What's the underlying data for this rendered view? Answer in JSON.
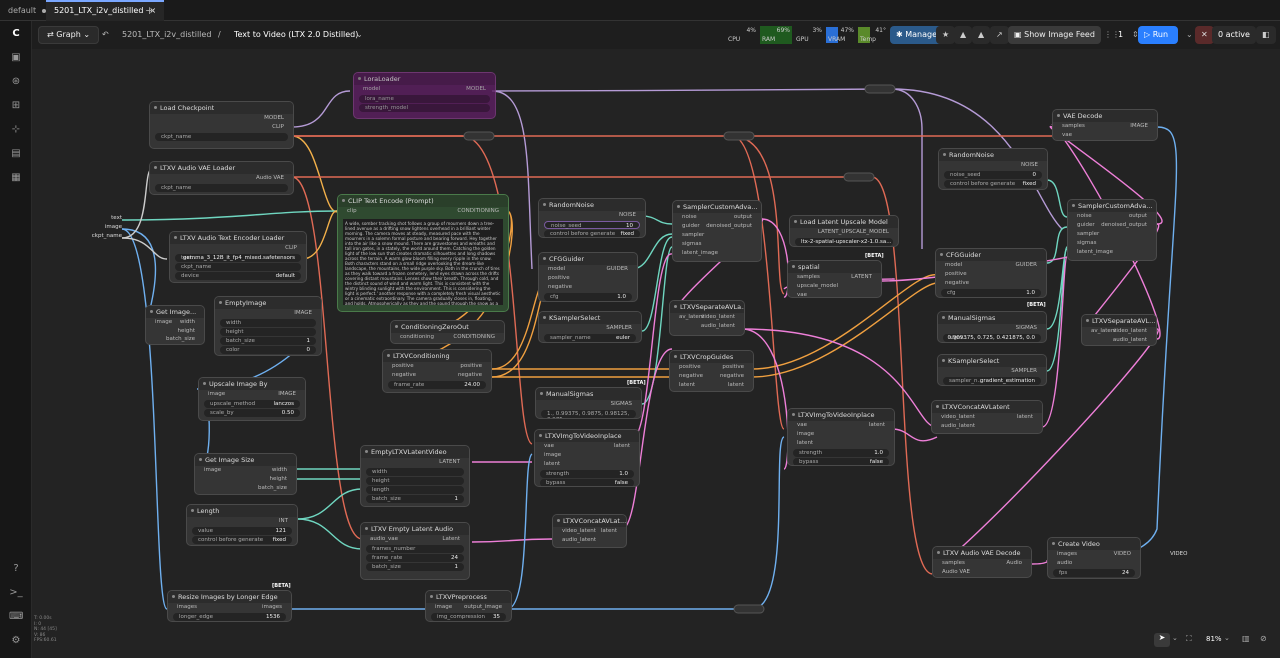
{
  "tabs": [
    {
      "label": "default"
    },
    {
      "label": "5201_LTX_i2v_distilled"
    }
  ],
  "toolbar": {
    "graph_label": "Graph",
    "breadcrumb_parent": "5201_LTX_i2v_distilled",
    "breadcrumb_sep": "/",
    "breadcrumb_current": "Text to Video (LTX 2.0 Distilled)",
    "cpu": {
      "label": "CPU",
      "value": "4%"
    },
    "ram": {
      "label": "RAM",
      "value": "69%"
    },
    "gpu": {
      "label": "GPU",
      "value": "3%"
    },
    "vram": {
      "label": "VRAM",
      "value": "47%"
    },
    "temp": {
      "label": "Temp",
      "value": "41°"
    },
    "manager_label": "Manager",
    "image_feed_label": "Show Image Feed",
    "queue_count": "1",
    "run_label": "Run",
    "active_label": "0 active"
  },
  "colors": {
    "accent": "#2a7fff",
    "ram_green": "#2a8a2a",
    "vram_blue": "#2a6fd6",
    "temp_green": "#5a8a2a",
    "clip_wire": "#f2b04a",
    "model_wire": "#b59bd6",
    "vae_wire": "#e06a55",
    "latent_wire": "#ee7fd8",
    "image_wire": "#6fb0f0",
    "cond_wire": "#f0a040",
    "guider_wire": "#6fd6c0"
  },
  "nodes": {
    "load_checkpoint": {
      "title": "Load Checkpoint",
      "out_model": "MODEL",
      "out_clip": "CLIP",
      "out_vae": "VAE",
      "widget": "ckpt_name"
    },
    "audio_vae_loader": {
      "title": "LTXV Audio VAE Loader",
      "out": "Audio VAE",
      "widget": "ckpt_name"
    },
    "text_encoder_loader": {
      "title": "LTXV Audio Text Encoder Loader",
      "out": "CLIP",
      "w1_label": "text...",
      "w1_value": "gemma_3_12B_it_fp4_mixed.safetensors",
      "w2_label": "ckpt_name",
      "w3_label": "device",
      "w3_value": "default"
    },
    "inputs": {
      "text": "text",
      "image": "image",
      "ckpt_name": "ckpt_name"
    },
    "get_image": {
      "title": "Get Image...",
      "in": "image",
      "width": "width",
      "height": "height",
      "batch_size": "batch_size"
    },
    "empty_image": {
      "title": "EmptyImage",
      "out": "IMAGE",
      "w1": "width",
      "w2": "height",
      "w3_label": "batch_size",
      "w3_value": "1",
      "w4_label": "color",
      "w4_value": "0"
    },
    "upscale_image_by": {
      "title": "Upscale Image By",
      "in": "image",
      "out": "IMAGE",
      "w1_label": "upscale_method",
      "w1_value": "lanczos",
      "w2_label": "scale_by",
      "w2_value": "0.50"
    },
    "get_image_size": {
      "title": "Get Image Size",
      "in": "image",
      "width": "width",
      "height": "height",
      "batch_size": "batch_size"
    },
    "length": {
      "title": "Length",
      "out": "INT",
      "w1_label": "value",
      "w1_value": "121",
      "w2_label": "control before generate",
      "w2_value": "fixed"
    },
    "resize_longer_edge": {
      "title": "Resize Images by Longer Edge",
      "in": "images",
      "out": "images",
      "w1_label": "longer_edge",
      "w1_value": "1536",
      "beta": "[BETA]"
    },
    "ltxv_preprocess": {
      "title": "LTXVPreprocess",
      "in": "image",
      "out": "output_image",
      "w1_label": "img_compression",
      "w1_value": "35"
    },
    "model_sampling_bypassed": {
      "title": "LoraLoader",
      "in": "model",
      "out": "MODEL",
      "w1": "lora_name",
      "w2": "strength_model"
    },
    "clip_text_encode": {
      "title": "CLIP Text Encode (Prompt)",
      "in": "clip",
      "out": "CONDITIONING",
      "text": "A wide, somber tracking shot follows a group of mourners down a tree-lined avenue as a drifting snow lightens overhead in a brilliant winter morning. The camera moves at steady, measured pace with the mourners in a solemn formal posture and bearing forward. Hey together into the air like a snow mound. There are gravestones and wreaths and tall iron gates, in a stately, the world around them. Catching the golden light of the low sun that creates dramatic silhouettes and long shadows across the terrain. A warm glow bloom filling every ripple in the snow. Both characters stand on a small ridge overlooking the dream-like landscape, the mountains, the wide purple sky. Both in the crunch of tires as they walk toward a frozen cemetery, lend eyes drawn across the drifts covering distant mountains. Lenses show their breath. Through cold, and the distinct sound of wind and warm light. This is consistent with the wintry blinding sunlight with the environment. This is considering the light is perfect.' another response with a completely fresh visual aesthetic or a cinematic extraordinary. The camera gradually closes in, floating, and holds. Atmospherically as they and the sound through the snow as a faint light in the sky. A distant sound of birds overhead, a bridge across the river, slightly silvering the sky. The clear and brilliant, along the edge. The mood is contemplative, hard-edged, and full of the fine detail of winter morning, with ethnic hope and grief captured in crisp light against the brilliant white snow and vibrant sky."
    },
    "cond_zero_out": {
      "title": "ConditioningZeroOut",
      "in": "conditioning",
      "out": "CONDITIONING"
    },
    "ltxv_conditioning": {
      "title": "LTXVConditioning",
      "in_pos": "positive",
      "in_neg": "negative",
      "out_pos": "positive",
      "out_neg": "negative",
      "w1_label": "frame_rate",
      "w1_value": "24.00"
    },
    "random_noise_1": {
      "title": "RandomNoise",
      "out": "NOISE",
      "w1_label": "noise_seed",
      "w1_value": "10",
      "w2_label": "control before generate",
      "w2_value": "fixed"
    },
    "cfg_guider_1": {
      "title": "CFGGuider",
      "in1": "model",
      "in2": "positive",
      "in3": "negative",
      "out": "GUIDER",
      "w1_label": "cfg",
      "w1_value": "1.0"
    },
    "ksampler_select_1": {
      "title": "KSamplerSelect",
      "out": "SAMPLER",
      "w1_label": "sampler_name",
      "w1_value": "euler"
    },
    "manual_sigmas_1": {
      "title": "ManualSigmas",
      "out": "SIGMAS",
      "w1_value": "1., 0.99375, 0.9875, 0.98125, 0.975,..."
    },
    "sampler_custom_1": {
      "title": "SamplerCustomAdva...",
      "in": [
        "noise",
        "guider",
        "sampler",
        "sigmas",
        "latent_image"
      ],
      "out1": "output",
      "out2": "denoised_output"
    },
    "separate_av_1": {
      "title": "LTXVSeparateAVLa...",
      "in": "av_latent",
      "out1": "video_latent",
      "out2": "audio_latent"
    },
    "crop_guides": {
      "title": "LTXVCropGuides",
      "in": [
        "positive",
        "negative",
        "latent"
      ],
      "out": [
        "positive",
        "negative",
        "latent"
      ],
      "beta": "[BETA]"
    },
    "img_to_video_1": {
      "title": "LTXVImgToVideoInplace",
      "in": [
        "vae",
        "image",
        "latent"
      ],
      "out": "latent",
      "w1_label": "strength",
      "w1_value": "1.0",
      "w2_label": "bypass",
      "w2_value": "false"
    },
    "empty_latent_video": {
      "title": "EmptyLTXVLatentVideo",
      "out": "LATENT",
      "w1": "width",
      "w2": "height",
      "w3": "length",
      "w4_label": "batch_size",
      "w4_value": "1"
    },
    "empty_latent_audio": {
      "title": "LTXV Empty Latent Audio",
      "in": "audio_vae",
      "out": "Latent",
      "w1": "frames_number",
      "w2_label": "frame_rate",
      "w2_value": "24",
      "w3_label": "batch_size",
      "w3_value": "1"
    },
    "concat_av_1": {
      "title": "LTXVConcatAVLat...",
      "in1": "video_latent",
      "in2": "audio_latent",
      "out": "latent"
    },
    "latent_upscale_model": {
      "title": "Load Latent Upscale Model",
      "out": "LATENT_UPSCALE_MODEL",
      "w1_value": "ltx-2-spatial-upscaler-x2-1.0.sa...",
      "beta": "[BETA]"
    },
    "spatial": {
      "title": "spatial",
      "in": [
        "samples",
        "upscale_model",
        "vae"
      ],
      "out": "LATENT"
    },
    "img_to_video_2": {
      "title": "LTXVImgToVideoInplace",
      "in": [
        "vae",
        "image",
        "latent"
      ],
      "out": "latent",
      "w1_label": "strength",
      "w1_value": "1.0",
      "w2_label": "bypass",
      "w2_value": "false"
    },
    "random_noise_2": {
      "title": "RandomNoise",
      "out": "NOISE",
      "w1_label": "noise_seed",
      "w1_value": "0",
      "w2_label": "control before generate",
      "w2_value": "fixed"
    },
    "cfg_guider_2": {
      "title": "CFGGuider",
      "in1": "model",
      "in2": "positive",
      "in3": "negative",
      "out": "GUIDER",
      "w1_label": "cfg",
      "w1_value": "1.0",
      "beta": "[BETA]"
    },
    "manual_sigmas_2": {
      "title": "ManualSigmas",
      "out": "SIGMAS",
      "w1_label": "sigm...",
      "w1_value": "0.909375, 0.725, 0.421875, 0.0"
    },
    "ksampler_select_2": {
      "title": "KSamplerSelect",
      "out": "SAMPLER",
      "w1_label": "sampler_n...",
      "w1_value": "gradient_estimation"
    },
    "concat_av_2": {
      "title": "LTXVConcatAVLatent",
      "in1": "video_latent",
      "in2": "audio_latent",
      "out": "latent"
    },
    "vae_decode": {
      "title": "VAE Decode",
      "in1": "samples",
      "in2": "vae",
      "out": "IMAGE"
    },
    "sampler_custom_2": {
      "title": "SamplerCustomAdva...",
      "in": [
        "noise",
        "guider",
        "sampler",
        "sigmas",
        "latent_image"
      ],
      "out1": "output",
      "out2": "denoised_output"
    },
    "separate_av_2": {
      "title": "LTXVSeparateAVL...",
      "in": "av_latent",
      "out1": "video_latent",
      "out2": "audio_latent"
    },
    "audio_vae_decode": {
      "title": "LTXV Audio VAE Decode",
      "in1": "samples",
      "in2": "Audio VAE",
      "out": "Audio"
    },
    "create_video": {
      "title": "Create Video",
      "in1": "images",
      "in2": "audio",
      "out": "VIDEO",
      "w1_label": "fps",
      "w1_value": "24"
    },
    "output_video": "VIDEO"
  },
  "status": {
    "l1": "T: 0.00s",
    "l2": "I: 0",
    "l3": "N: 44 [45]",
    "l4": "V: 86",
    "l5": "FPS:60.61"
  },
  "canvas_controls": {
    "zoom": "81%"
  }
}
